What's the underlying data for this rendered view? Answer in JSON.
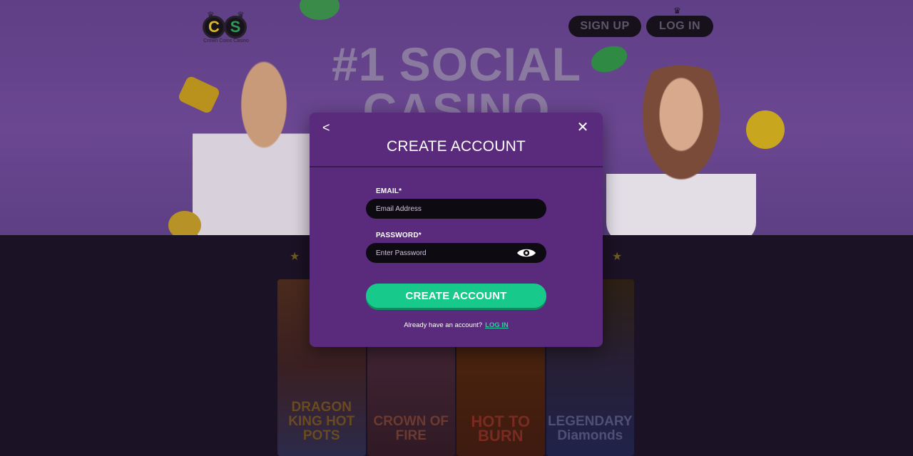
{
  "site": {
    "logo_tag": "Crown Coins Casino",
    "logo_letters": [
      "C",
      "S"
    ]
  },
  "header": {
    "signup_label": "SIGN UP",
    "login_label": "LOG IN"
  },
  "hero": {
    "title_line1": "#1 SOCIAL",
    "title_line2": "CASINO"
  },
  "games": [
    {
      "title": "DRAGON KING HOT POTS"
    },
    {
      "title": "CROWN OF FIRE"
    },
    {
      "title": "HOT TO BURN"
    },
    {
      "title": "LEGENDARY Diamonds"
    }
  ],
  "modal": {
    "back_glyph": "<",
    "close_glyph": "✕",
    "title": "CREATE ACCOUNT",
    "email_label": "EMAIL*",
    "email_placeholder": "Email Address",
    "email_value": "",
    "password_label": "PASSWORD*",
    "password_placeholder": "Enter Password",
    "password_value": "",
    "submit_label": "CREATE ACCOUNT",
    "footer_text": "Already have an account?",
    "footer_link": "LOG IN"
  },
  "icons": {
    "back": "chevron-left-icon",
    "close": "close-icon",
    "password_toggle": "eye-icon"
  },
  "colors": {
    "modal_bg": "#5a2a7c",
    "accent_green": "#17c98a",
    "link_green": "#2ad2a0",
    "input_bg": "#0e0a12"
  }
}
